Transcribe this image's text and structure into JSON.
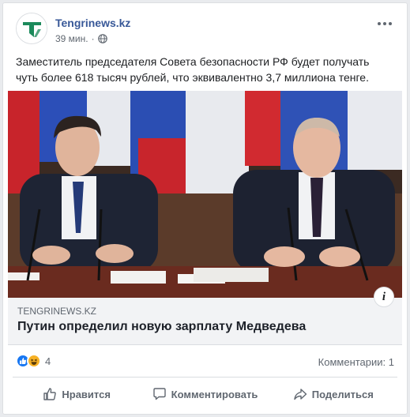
{
  "post": {
    "page_name": "Tengrinews.kz",
    "time": "39 мин.",
    "separator": "·",
    "text": "Заместитель председателя Совета безопасности РФ будет получать чуть более 618 тысяч рублей, что эквивалентно 3,7 миллиона тенге."
  },
  "link": {
    "domain": "TENGRINEWS.KZ",
    "headline": "Путин определил новую зарплату Медведева",
    "info_icon": "i"
  },
  "stats": {
    "reaction_count": "4",
    "comments": "Комментарии: 1"
  },
  "actions": {
    "like": "Нравится",
    "comment": "Комментировать",
    "share": "Поделиться"
  },
  "colors": {
    "link_blue": "#385898",
    "logo_green": "#1c8a5b",
    "like_blue": "#1877f2",
    "haha_yellow": "#f7b125"
  },
  "icons": [
    "globe-icon",
    "more-options-icon",
    "info-icon",
    "like-reaction-icon",
    "haha-reaction-icon",
    "thumbs-up-icon",
    "comment-icon",
    "share-icon"
  ]
}
